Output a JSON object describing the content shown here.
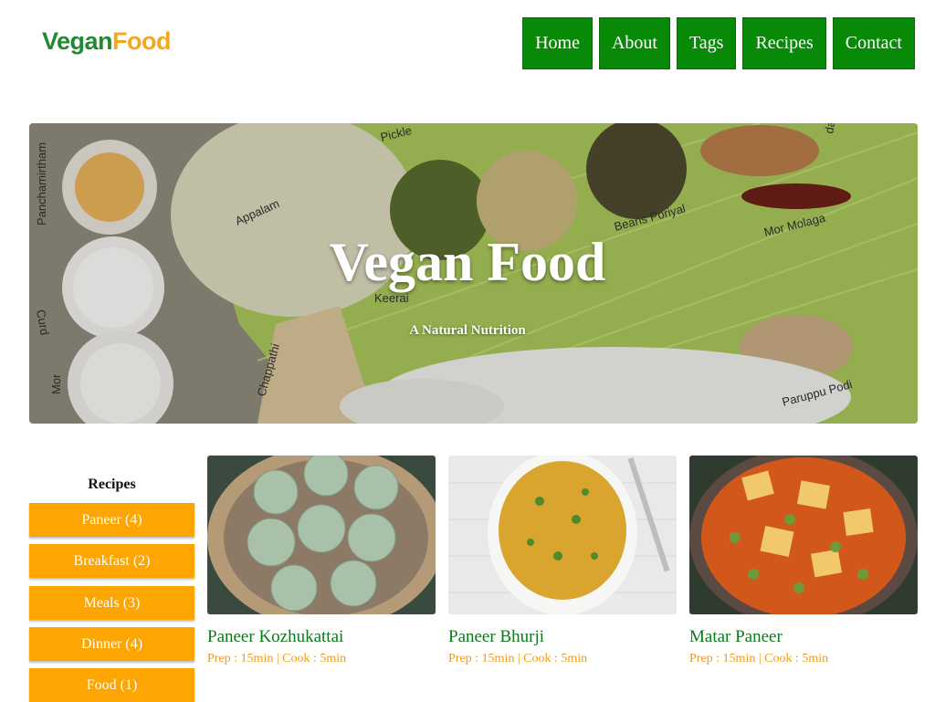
{
  "header": {
    "logo_part1": "Vegan",
    "logo_part2": "Food",
    "nav": [
      {
        "label": "Home"
      },
      {
        "label": "About"
      },
      {
        "label": "Tags"
      },
      {
        "label": "Recipes"
      },
      {
        "label": "Contact"
      }
    ]
  },
  "hero": {
    "title": "Vegan Food",
    "subtitle": "A Natural Nutrition",
    "photo_labels": [
      "Pickle",
      "Appalam",
      "Panchamirtham",
      "Beans Poriyal",
      "Mor Molaga",
      "Curd",
      "Keerai",
      "Chappathi",
      "Mor",
      "Paruppu Podi",
      "dal"
    ]
  },
  "sidebar": {
    "title": "Recipes",
    "items": [
      {
        "label": "Paneer (4)"
      },
      {
        "label": "Breakfast (2)"
      },
      {
        "label": "Meals (3)"
      },
      {
        "label": "Dinner (4)"
      },
      {
        "label": "Food (1)"
      }
    ]
  },
  "recipes": [
    {
      "title": "Paneer Kozhukattai",
      "meta": "Prep : 15min | Cook : 5min"
    },
    {
      "title": "Paneer Bhurji",
      "meta": "Prep : 15min | Cook : 5min"
    },
    {
      "title": "Matar Paneer",
      "meta": "Prep : 15min | Cook : 5min"
    }
  ],
  "colors": {
    "nav_bg": "#088a08",
    "sidebar_button_bg": "#fca503",
    "recipe_title": "#0a7a1a",
    "recipe_meta": "#f29b12",
    "logo_green": "#1f8a32",
    "logo_orange": "#f4a81d"
  }
}
